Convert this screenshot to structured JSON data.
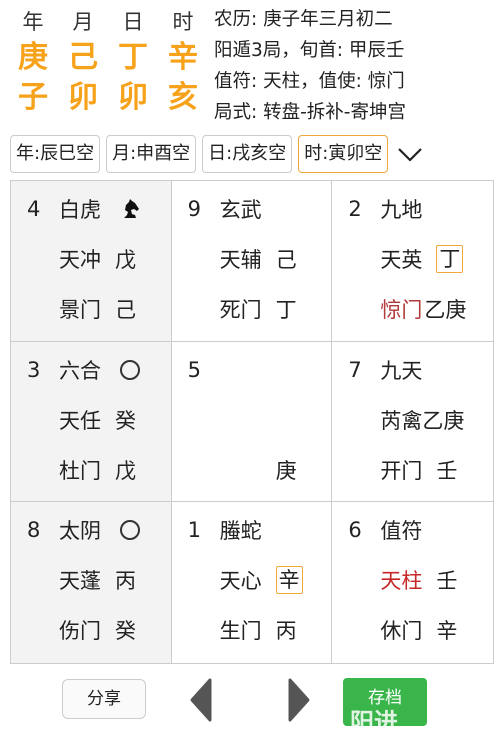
{
  "pillars": {
    "labels": [
      "年",
      "月",
      "日",
      "时"
    ],
    "stems": [
      "庚",
      "己",
      "丁",
      "辛"
    ],
    "branches": [
      "子",
      "卯",
      "卯",
      "亥"
    ]
  },
  "info": {
    "lunar": "农历: 庚子年三月初二",
    "ju": "阳遁3局，旬首: 甲辰壬",
    "zhifu": "值符: 天柱，值使: 惊门",
    "style": "局式: 转盘-拆补-寄坤宫"
  },
  "void": [
    "年:辰巳空",
    "月:申酉空",
    "日:戌亥空",
    "时:寅卯空"
  ],
  "accent": "#F7A21B",
  "cells": [
    {
      "num": "4",
      "god": "白虎",
      "mark": "horse",
      "star": "天冲",
      "star_stem": "戊",
      "door": "景门",
      "door_stem": "己"
    },
    {
      "num": "9",
      "god": "玄武",
      "star": "天辅",
      "star_stem": "己",
      "door": "死门",
      "door_stem": "丁"
    },
    {
      "num": "2",
      "god": "九地",
      "star": "天英",
      "star_stem": "丁",
      "door": "惊门",
      "door_stem": "乙庚"
    },
    {
      "num": "3",
      "god": "六合",
      "mark": "circle",
      "star": "天任",
      "star_stem": "癸",
      "door": "杜门",
      "door_stem": "戊"
    },
    {
      "num": "5",
      "door_stem": "庚"
    },
    {
      "num": "7",
      "god": "九天",
      "star": "芮禽乙庚",
      "door": "开门",
      "door_stem": "壬"
    },
    {
      "num": "8",
      "god": "太阴",
      "mark": "circle",
      "star": "天蓬",
      "star_stem": "丙",
      "door": "伤门",
      "door_stem": "癸"
    },
    {
      "num": "1",
      "god": "螣蛇",
      "star": "天心",
      "star_stem": "辛",
      "door": "生门",
      "door_stem": "丙"
    },
    {
      "num": "6",
      "god": "值符",
      "star": "天柱",
      "star_stem": "壬",
      "door": "休门",
      "door_stem": "辛"
    }
  ],
  "footer": {
    "share": "分享",
    "save": "存档",
    "advance": "阳进"
  }
}
